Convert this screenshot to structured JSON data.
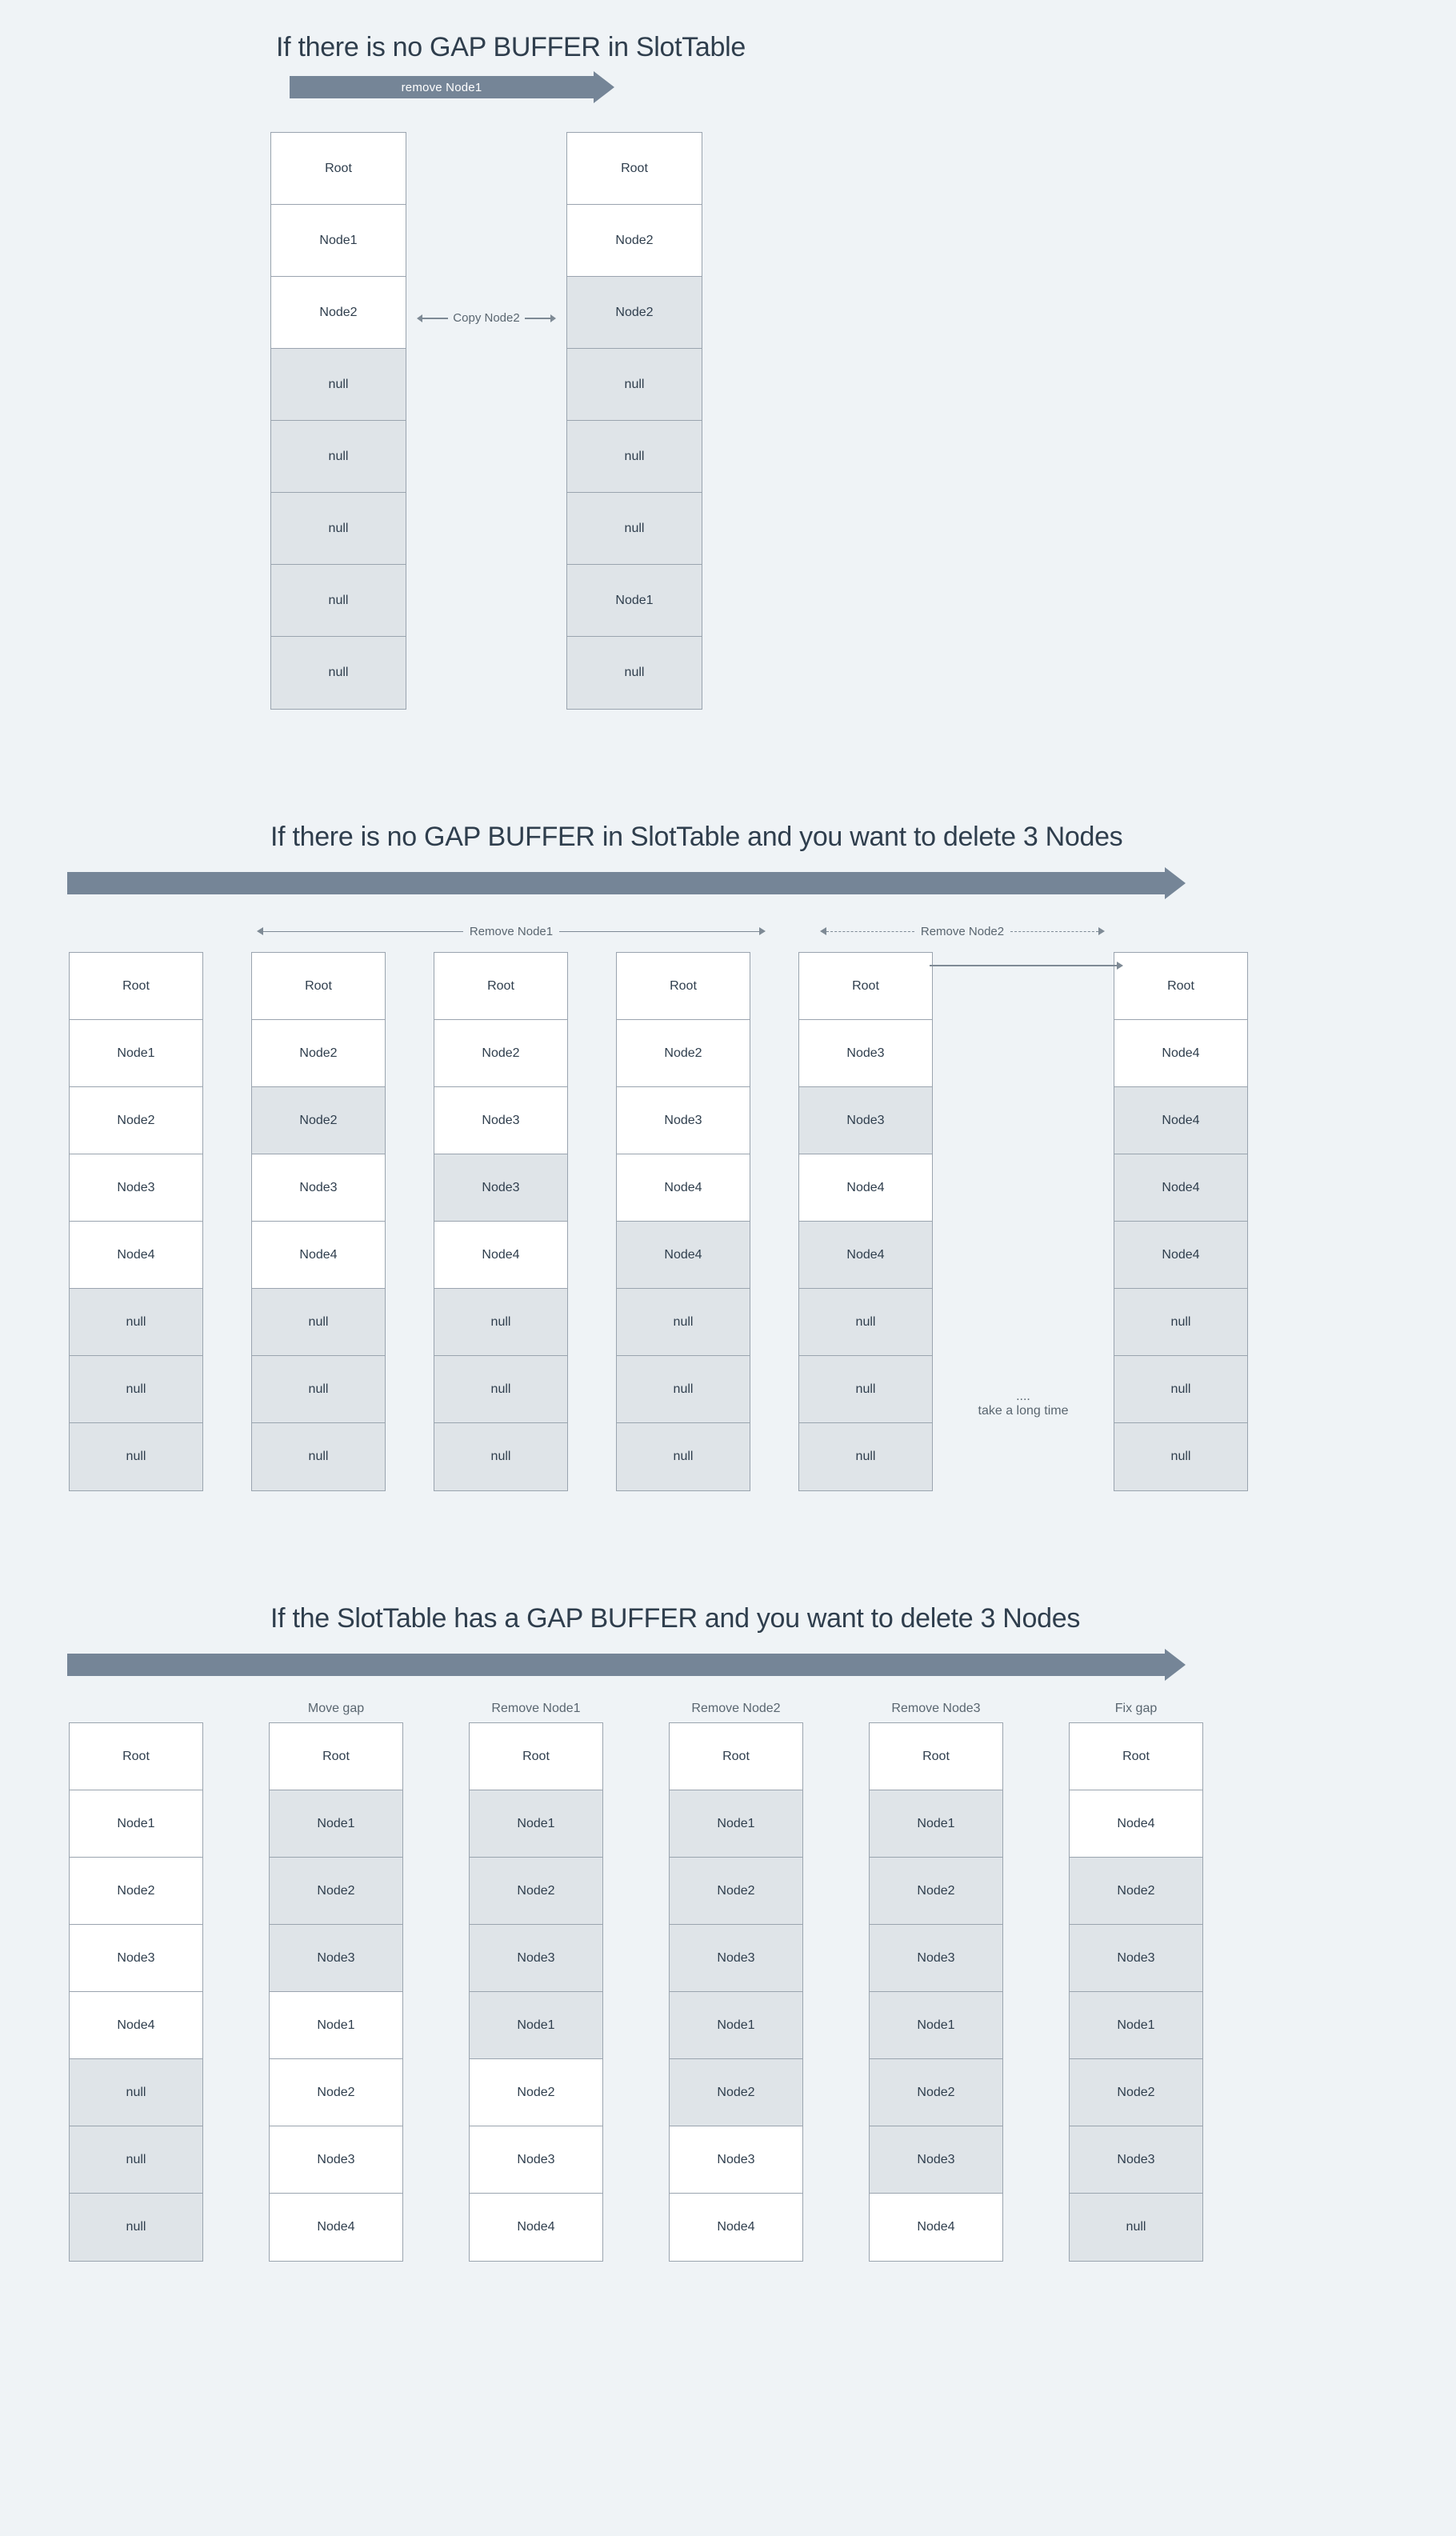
{
  "section1": {
    "title": "If there is no GAP BUFFER in SlotTable",
    "arrow_label": "remove Node1",
    "mid_label": "Copy Node2",
    "cols": [
      {
        "cells": [
          {
            "t": "Root",
            "g": false
          },
          {
            "t": "Node1",
            "g": false
          },
          {
            "t": "Node2",
            "g": false
          },
          {
            "t": "null",
            "g": true
          },
          {
            "t": "null",
            "g": true
          },
          {
            "t": "null",
            "g": true
          },
          {
            "t": "null",
            "g": true
          },
          {
            "t": "null",
            "g": true
          }
        ]
      },
      {
        "cells": [
          {
            "t": "Root",
            "g": false
          },
          {
            "t": "Node2",
            "g": false
          },
          {
            "t": "Node2",
            "g": true
          },
          {
            "t": "null",
            "g": true
          },
          {
            "t": "null",
            "g": true
          },
          {
            "t": "null",
            "g": true
          },
          {
            "t": "Node1",
            "g": true
          },
          {
            "t": "null",
            "g": true
          }
        ]
      }
    ]
  },
  "section2": {
    "title": "If there is no GAP BUFFER in SlotTable and you want to delete 3 Nodes",
    "range1": "Remove Node1",
    "range2": "Remove Node2",
    "tween_dots": "....",
    "tween_text": "take a long time",
    "cols": [
      {
        "cells": [
          {
            "t": "Root",
            "g": false
          },
          {
            "t": "Node1",
            "g": false
          },
          {
            "t": "Node2",
            "g": false
          },
          {
            "t": "Node3",
            "g": false
          },
          {
            "t": "Node4",
            "g": false
          },
          {
            "t": "null",
            "g": true
          },
          {
            "t": "null",
            "g": true
          },
          {
            "t": "null",
            "g": true
          }
        ]
      },
      {
        "cells": [
          {
            "t": "Root",
            "g": false
          },
          {
            "t": "Node2",
            "g": false
          },
          {
            "t": "Node2",
            "g": true
          },
          {
            "t": "Node3",
            "g": false
          },
          {
            "t": "Node4",
            "g": false
          },
          {
            "t": "null",
            "g": true
          },
          {
            "t": "null",
            "g": true
          },
          {
            "t": "null",
            "g": true
          }
        ]
      },
      {
        "cells": [
          {
            "t": "Root",
            "g": false
          },
          {
            "t": "Node2",
            "g": false
          },
          {
            "t": "Node3",
            "g": false
          },
          {
            "t": "Node3",
            "g": true
          },
          {
            "t": "Node4",
            "g": false
          },
          {
            "t": "null",
            "g": true
          },
          {
            "t": "null",
            "g": true
          },
          {
            "t": "null",
            "g": true
          }
        ]
      },
      {
        "cells": [
          {
            "t": "Root",
            "g": false
          },
          {
            "t": "Node2",
            "g": false
          },
          {
            "t": "Node3",
            "g": false
          },
          {
            "t": "Node4",
            "g": false
          },
          {
            "t": "Node4",
            "g": true
          },
          {
            "t": "null",
            "g": true
          },
          {
            "t": "null",
            "g": true
          },
          {
            "t": "null",
            "g": true
          }
        ]
      },
      {
        "cells": [
          {
            "t": "Root",
            "g": false
          },
          {
            "t": "Node3",
            "g": false
          },
          {
            "t": "Node3",
            "g": true
          },
          {
            "t": "Node4",
            "g": false
          },
          {
            "t": "Node4",
            "g": true
          },
          {
            "t": "null",
            "g": true
          },
          {
            "t": "null",
            "g": true
          },
          {
            "t": "null",
            "g": true
          }
        ]
      },
      {
        "cells": [
          {
            "t": "Root",
            "g": false
          },
          {
            "t": "Node4",
            "g": false
          },
          {
            "t": "Node4",
            "g": true
          },
          {
            "t": "Node4",
            "g": true
          },
          {
            "t": "Node4",
            "g": true
          },
          {
            "t": "null",
            "g": true
          },
          {
            "t": "null",
            "g": true
          },
          {
            "t": "null",
            "g": true
          }
        ]
      }
    ]
  },
  "section3": {
    "title": "If the SlotTable has a GAP BUFFER and you want to delete 3 Nodes",
    "headers": [
      "",
      "Move gap",
      "Remove Node1",
      "Remove Node2",
      "Remove Node3",
      "Fix gap"
    ],
    "cols": [
      {
        "cells": [
          {
            "t": "Root",
            "g": false
          },
          {
            "t": "Node1",
            "g": false
          },
          {
            "t": "Node2",
            "g": false
          },
          {
            "t": "Node3",
            "g": false
          },
          {
            "t": "Node4",
            "g": false
          },
          {
            "t": "null",
            "g": true
          },
          {
            "t": "null",
            "g": true
          },
          {
            "t": "null",
            "g": true
          }
        ]
      },
      {
        "cells": [
          {
            "t": "Root",
            "g": false
          },
          {
            "t": "Node1",
            "g": true
          },
          {
            "t": "Node2",
            "g": true
          },
          {
            "t": "Node3",
            "g": true
          },
          {
            "t": "Node1",
            "g": false
          },
          {
            "t": "Node2",
            "g": false
          },
          {
            "t": "Node3",
            "g": false
          },
          {
            "t": "Node4",
            "g": false
          }
        ]
      },
      {
        "cells": [
          {
            "t": "Root",
            "g": false
          },
          {
            "t": "Node1",
            "g": true
          },
          {
            "t": "Node2",
            "g": true
          },
          {
            "t": "Node3",
            "g": true
          },
          {
            "t": "Node1",
            "g": true
          },
          {
            "t": "Node2",
            "g": false
          },
          {
            "t": "Node3",
            "g": false
          },
          {
            "t": "Node4",
            "g": false
          }
        ]
      },
      {
        "cells": [
          {
            "t": "Root",
            "g": false
          },
          {
            "t": "Node1",
            "g": true
          },
          {
            "t": "Node2",
            "g": true
          },
          {
            "t": "Node3",
            "g": true
          },
          {
            "t": "Node1",
            "g": true
          },
          {
            "t": "Node2",
            "g": true
          },
          {
            "t": "Node3",
            "g": false
          },
          {
            "t": "Node4",
            "g": false
          }
        ]
      },
      {
        "cells": [
          {
            "t": "Root",
            "g": false
          },
          {
            "t": "Node1",
            "g": true
          },
          {
            "t": "Node2",
            "g": true
          },
          {
            "t": "Node3",
            "g": true
          },
          {
            "t": "Node1",
            "g": true
          },
          {
            "t": "Node2",
            "g": true
          },
          {
            "t": "Node3",
            "g": true
          },
          {
            "t": "Node4",
            "g": false
          }
        ]
      },
      {
        "cells": [
          {
            "t": "Root",
            "g": false
          },
          {
            "t": "Node4",
            "g": false
          },
          {
            "t": "Node2",
            "g": true
          },
          {
            "t": "Node3",
            "g": true
          },
          {
            "t": "Node1",
            "g": true
          },
          {
            "t": "Node2",
            "g": true
          },
          {
            "t": "Node3",
            "g": true
          },
          {
            "t": "null",
            "g": true
          }
        ]
      }
    ]
  }
}
